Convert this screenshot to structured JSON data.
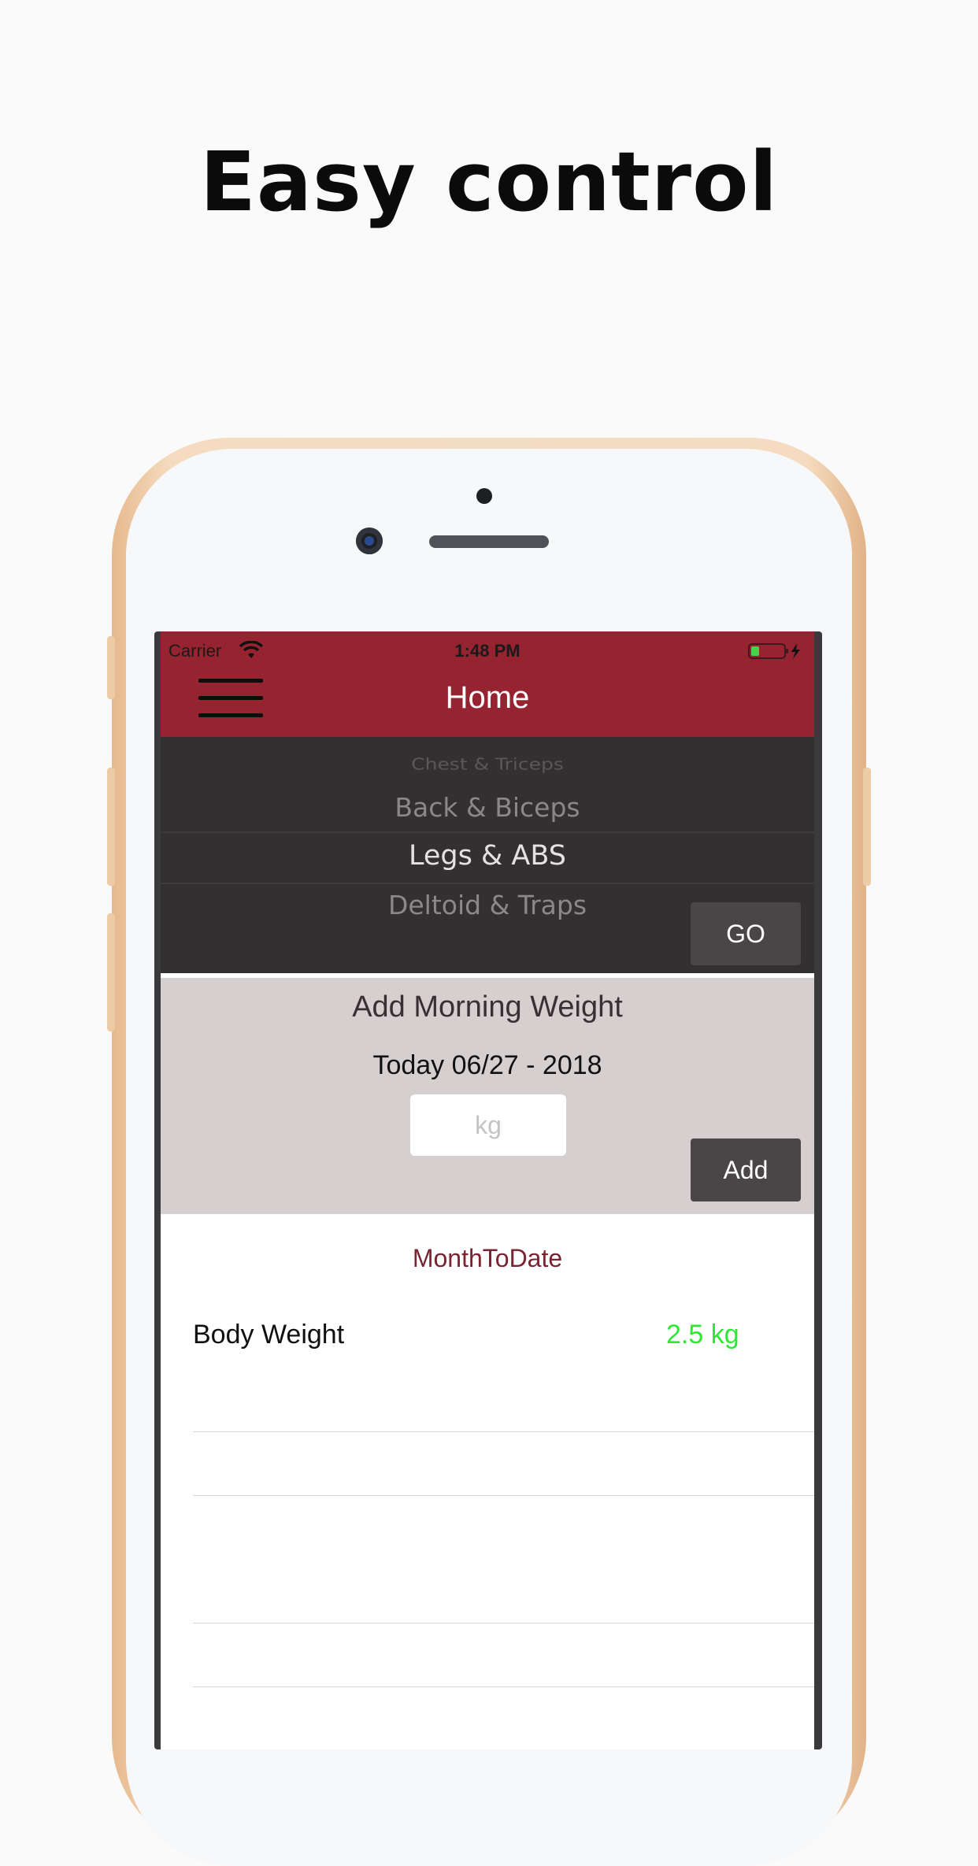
{
  "headline": "Easy control",
  "status_bar": {
    "carrier": "Carrier",
    "time": "1:48 PM",
    "wifi_icon": "wifi-icon",
    "battery_icon": "battery-charging-icon"
  },
  "nav": {
    "title": "Home",
    "menu_icon": "hamburger-menu-icon"
  },
  "picker": {
    "items": [
      "Chest & Triceps",
      "Back & Biceps",
      "Legs & ABS",
      "Deltoid & Traps"
    ],
    "selected": "Legs & ABS",
    "go_label": "GO"
  },
  "weight_panel": {
    "title": "Add Morning Weight",
    "date": "Today 06/27 - 2018",
    "input_placeholder": "kg",
    "add_label": "Add"
  },
  "stats": {
    "title": "MonthToDate",
    "rows": [
      {
        "label": "Body Weight",
        "value": "2.5 kg"
      }
    ]
  },
  "colors": {
    "brand_red": "#962330",
    "picker_bg": "#333031",
    "panel_bg": "#d6cfcf",
    "button_bg": "#4a4647",
    "positive_green": "#2ee834",
    "section_title": "#7a2331"
  }
}
